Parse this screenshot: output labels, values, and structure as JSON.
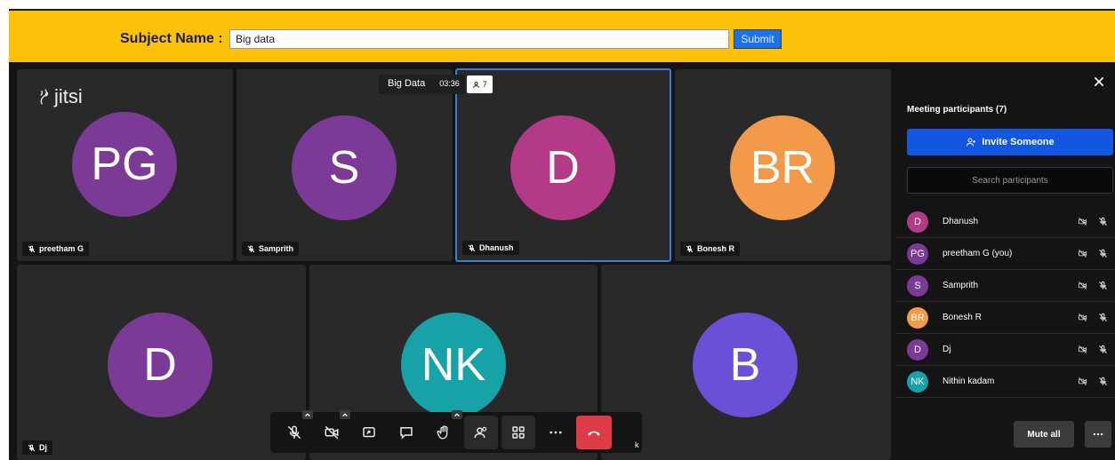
{
  "subject": {
    "label": "Subject Name :",
    "value": "Big data",
    "submit_label": "Submit"
  },
  "logo": {
    "text": "jitsi"
  },
  "meeting": {
    "title": "Big Data",
    "time": "03:36",
    "participant_count": "7"
  },
  "tiles": [
    {
      "initials": "PG",
      "name": "preetham G",
      "color": "#7b3a96"
    },
    {
      "initials": "S",
      "name": "Samprith",
      "color": "#7b3a96"
    },
    {
      "initials": "D",
      "name": "Dhanush",
      "color": "#b23a86",
      "active": true
    },
    {
      "initials": "BR",
      "name": "Bonesh R",
      "color": "#f2994a"
    },
    {
      "initials": "D",
      "name": "Dj",
      "color": "#7b3a96"
    },
    {
      "initials": "NK",
      "name": "",
      "color": "#17a2a7"
    },
    {
      "initials": "B",
      "name": "",
      "color": "#6b4fd6"
    }
  ],
  "toolbar": {
    "buttons": [
      "microphone-muted-icon",
      "camera-off-icon",
      "screen-share-icon",
      "chat-icon",
      "raise-hand-icon",
      "participants-icon",
      "tile-view-icon",
      "more-icon",
      "hangup-icon"
    ],
    "trailing_text": "k"
  },
  "panel": {
    "title": "Meeting participants (7)",
    "invite_label": "Invite Someone",
    "search_placeholder": "Search participants",
    "participants": [
      {
        "initials": "D",
        "name": "Dhanush",
        "color": "#b23a86"
      },
      {
        "initials": "PG",
        "name": "preetham G (you)",
        "color": "#7b3a96"
      },
      {
        "initials": "S",
        "name": "Samprith",
        "color": "#7b3a96"
      },
      {
        "initials": "BR",
        "name": "Bonesh R",
        "color": "#f2994a"
      },
      {
        "initials": "D",
        "name": "Dj",
        "color": "#7b3a96"
      },
      {
        "initials": "NK",
        "name": "Nithin kadam",
        "color": "#17a2a7"
      }
    ],
    "mute_all_label": "Mute all"
  }
}
